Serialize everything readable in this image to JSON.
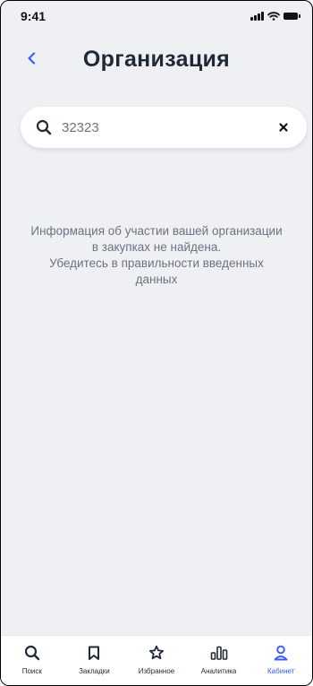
{
  "status_bar": {
    "time": "9:41"
  },
  "header": {
    "title": "Организация"
  },
  "search": {
    "value": "32323",
    "placeholder": ""
  },
  "empty_state": {
    "lines": [
      "Информация об участии вашей организации",
      "в закупках не найдена.",
      "Убедитесь в правильности введенных",
      "данных"
    ]
  },
  "tab_bar": {
    "items": [
      {
        "label": "Поиск",
        "icon": "search-icon",
        "active": false
      },
      {
        "label": "Закладки",
        "icon": "bookmark-icon",
        "active": false
      },
      {
        "label": "Избранное",
        "icon": "star-icon",
        "active": false
      },
      {
        "label": "Аналитика",
        "icon": "analytics-icon",
        "active": false
      },
      {
        "label": "Кабинет",
        "icon": "user-icon",
        "active": true
      }
    ]
  },
  "colors": {
    "background": "#eff0f4",
    "accent": "#3b5bfd",
    "title": "#1f2937",
    "muted_text": "#6b7280"
  }
}
